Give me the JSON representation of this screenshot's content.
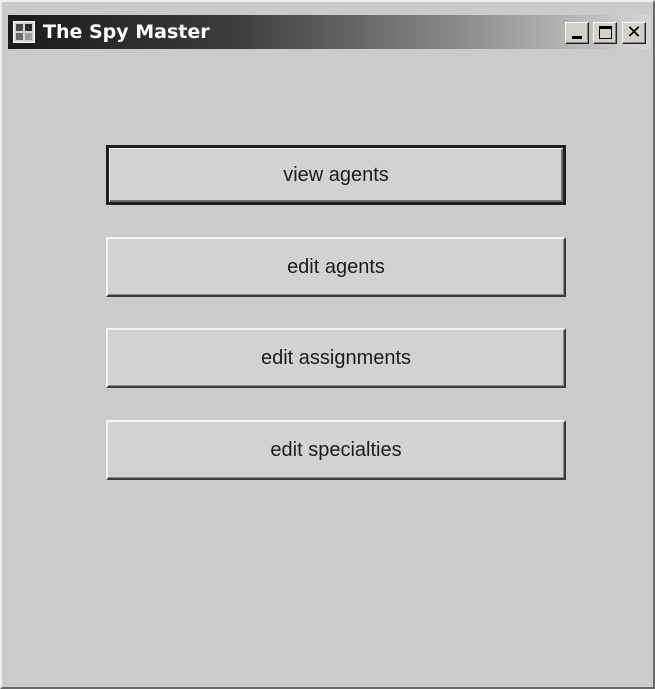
{
  "window": {
    "title": "The Spy Master",
    "controls": {
      "minimize_icon": "minimize-icon",
      "maximize_icon": "maximize-icon",
      "close_icon": "close-icon",
      "close_glyph": "✕"
    }
  },
  "buttons": [
    {
      "label": "view agents",
      "default": true
    },
    {
      "label": "edit agents"
    },
    {
      "label": "edit assignments"
    },
    {
      "label": "edit specialties"
    }
  ],
  "colors": {
    "window_background": "#cbcbcb",
    "titlebar_start": "#1a1a1a",
    "titlebar_end": "#d6d6d6",
    "title_text": "#ffffff"
  }
}
